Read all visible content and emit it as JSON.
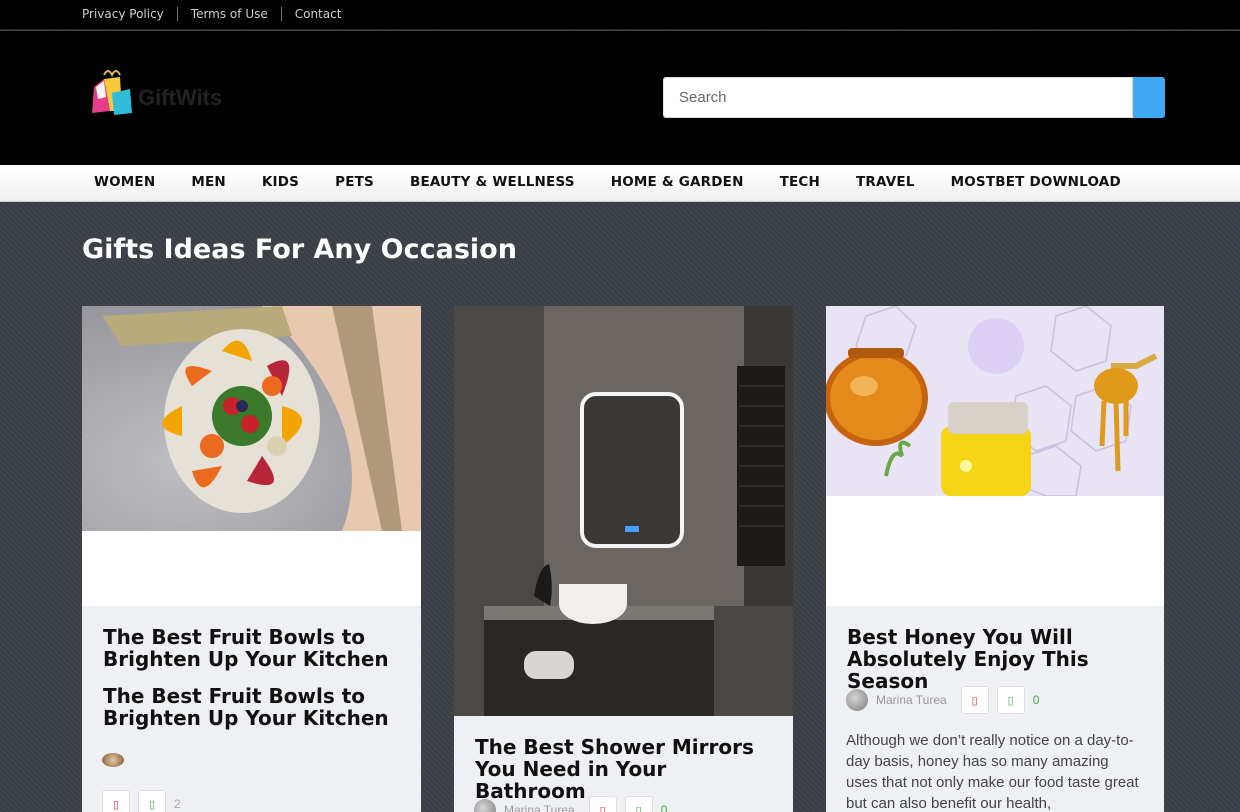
{
  "topbar": {
    "links": [
      "Privacy Policy",
      "Terms of Use",
      "Contact"
    ]
  },
  "header": {
    "logo_text": "GiftWits",
    "search_placeholder": "Search"
  },
  "nav": {
    "items": [
      "WOMEN",
      "MEN",
      "KIDS",
      "PETS",
      "BEAUTY & WELLNESS",
      "HOME & GARDEN",
      "TECH",
      "TRAVEL",
      "MOSTBET DOWNLOAD"
    ]
  },
  "section": {
    "title": "Gifts Ideas For Any Occasion"
  },
  "cards": [
    {
      "title": "The Best Fruit Bowls to Brighten Up Your Kitchen",
      "subtitle": "The Best Fruit Bowls to Brighten Up Your Kitchen",
      "votes_down_icon": "thumbs-down-icon",
      "votes_up_icon": "thumbs-up-icon",
      "count": "2"
    },
    {
      "title": "The Best Shower Mirrors You Need in Your Bathroom",
      "author": "Marina Turea",
      "count": "0"
    },
    {
      "title": "Best Honey You Will Absolutely Enjoy This Season",
      "author": "Marina Turea",
      "count": "0",
      "excerpt": "Although we don’t really notice on a day-to-day basis, honey has so many amazing uses that not only make our food taste great but can also benefit our health,"
    }
  ],
  "colors": {
    "accent": "#3fa9f5",
    "header_bg": "#000000",
    "page_bg": "#3b3f47"
  }
}
